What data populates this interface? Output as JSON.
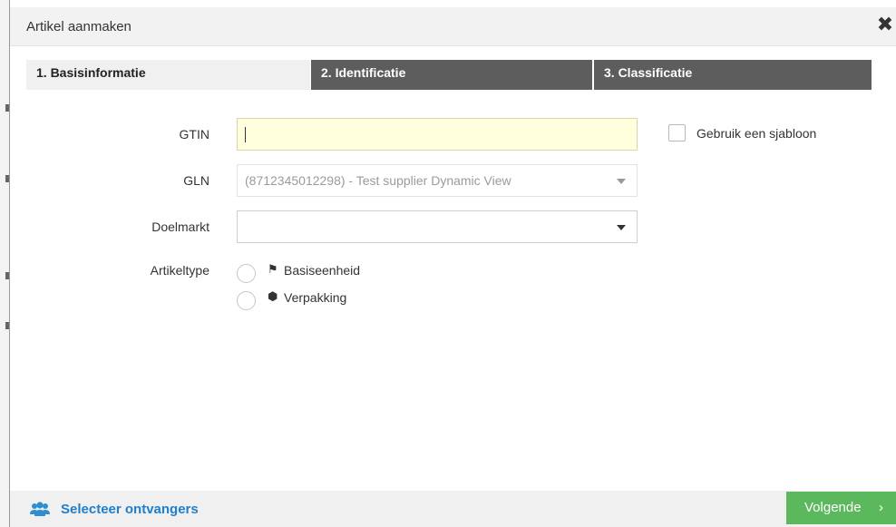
{
  "dialog": {
    "title": "Artikel aanmaken",
    "close_icon": "✖"
  },
  "steps": [
    {
      "label": "1. Basisinformatie"
    },
    {
      "label": "2. Identificatie"
    },
    {
      "label": "3. Classificatie"
    }
  ],
  "form": {
    "gtin": {
      "label": "GTIN",
      "value": ""
    },
    "gln": {
      "label": "GLN",
      "value": "(8712345012298) - Test supplier Dynamic View"
    },
    "doelmarkt": {
      "label": "Doelmarkt",
      "value": ""
    },
    "artikeltype": {
      "label": "Artikeltype",
      "options": [
        {
          "label": "Basiseenheid",
          "icon": "flag-icon",
          "glyph": "⚑"
        },
        {
          "label": "Verpakking",
          "icon": "cube-icon",
          "glyph": "⬢"
        }
      ]
    },
    "template_checkbox": {
      "label": "Gebruik een sjabloon",
      "checked": false
    }
  },
  "footer": {
    "recipients_label": "Selecteer ontvangers",
    "users_icon": "users-icon",
    "next_label": "Volgende",
    "next_chevron": "›"
  },
  "colors": {
    "accent_blue": "#1f7fcc",
    "next_green": "#5cb85c",
    "step_inactive": "#5d5d5d",
    "gtin_highlight": "#ffffdd"
  }
}
